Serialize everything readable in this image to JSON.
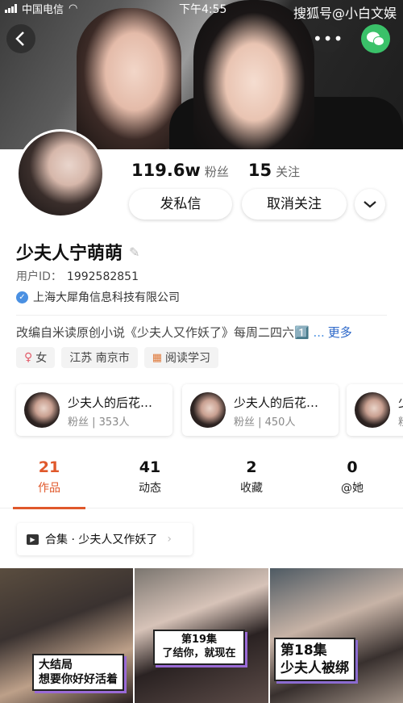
{
  "status_bar": {
    "carrier": "中国电信",
    "time": "下午4:55",
    "watermark": "搜狐号@小白文娱"
  },
  "header": {
    "more_label": "•••"
  },
  "profile": {
    "followers_count": "119.6w",
    "followers_label": "粉丝",
    "following_count": "15",
    "following_label": "关注",
    "message_button": "发私信",
    "unfollow_button": "取消关注",
    "name": "少夫人宁萌萌",
    "user_id_label": "用户ID：",
    "user_id": "1992582851",
    "verification": "上海大犀角信息科技有限公司",
    "bio": "改编自米读原创小说《少夫人又作妖了》每周二四六",
    "bio_emoji": "1️⃣ ...",
    "bio_more": "更多",
    "tags": [
      {
        "label": "女",
        "icon": "female-icon"
      },
      {
        "label": "江苏 南京市",
        "icon": ""
      },
      {
        "label": "阅读学习",
        "icon": "grid-icon"
      }
    ]
  },
  "collections": [
    {
      "title": "少夫人的后花…",
      "subtitle": "粉丝 | 353人"
    },
    {
      "title": "少夫人的后花…",
      "subtitle": "粉丝 | 450人"
    },
    {
      "title": "少",
      "subtitle": "粉"
    }
  ],
  "tabs": [
    {
      "count": "21",
      "label": "作品",
      "active": true
    },
    {
      "count": "41",
      "label": "动态",
      "active": false
    },
    {
      "count": "2",
      "label": "收藏",
      "active": false
    },
    {
      "count": "0",
      "label": "@她",
      "active": false
    }
  ],
  "album": {
    "label": "合集 · 少夫人又作妖了"
  },
  "videos": [
    {
      "caption_line1": "大结局",
      "caption_line2": "想要你好好活着"
    },
    {
      "caption_line1": "第19集",
      "caption_line2": "了结你，就现在"
    },
    {
      "caption_line1": "第18集",
      "caption_line2": "少夫人被绑"
    }
  ],
  "colors": {
    "accent": "#e0582b",
    "link": "#2a66c8",
    "wechat": "#3ac169",
    "verify": "#4a90e2"
  }
}
